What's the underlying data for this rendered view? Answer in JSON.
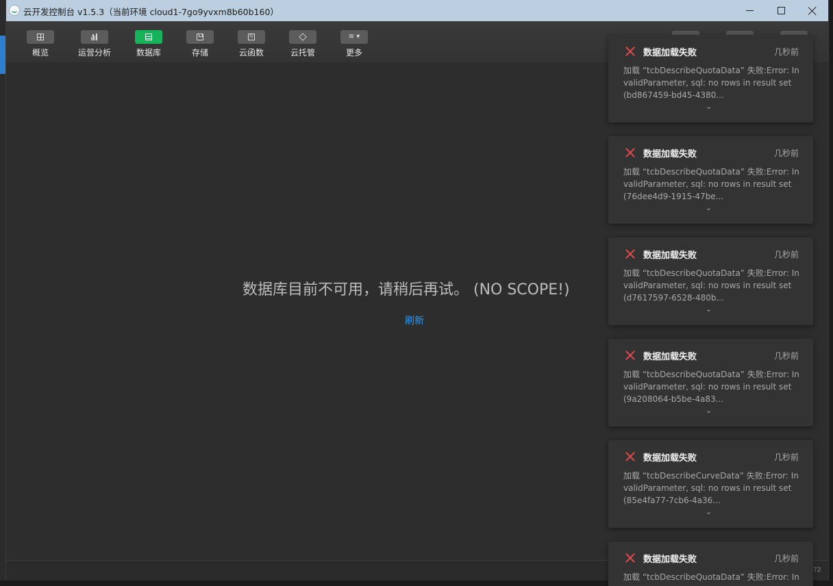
{
  "window": {
    "title": "云开发控制台 v1.5.3（当前环境 cloud1-7go9yvxm8b60b160）"
  },
  "toolbar": {
    "items": [
      {
        "label": "概览",
        "icon": "grid-icon"
      },
      {
        "label": "运营分析",
        "icon": "bar-chart-icon"
      },
      {
        "label": "数据库",
        "icon": "database-table-icon",
        "active": true
      },
      {
        "label": "存储",
        "icon": "disk-icon"
      },
      {
        "label": "云函数",
        "icon": "function-icon"
      },
      {
        "label": "云托管",
        "icon": "cube-icon"
      },
      {
        "label": "更多",
        "icon": "layers-dropdown-icon"
      }
    ]
  },
  "main": {
    "message": "数据库目前不可用，请稍后再试。 (NO SCOPE!)",
    "refresh": "刷新"
  },
  "status": {
    "number": "72"
  },
  "toasts": [
    {
      "title": "数据加载失败",
      "time": "几秒前",
      "body": "加载 “tcbDescribeQuotaData” 失败:Error: InvalidParameter, sql: no rows in result set (bd867459-bd45-4380...",
      "chevron": "⌄"
    },
    {
      "title": "数据加载失败",
      "time": "几秒前",
      "body": "加载 “tcbDescribeQuotaData” 失败:Error: InvalidParameter, sql: no rows in result set (76dee4d9-1915-47be...",
      "chevron": "⌄"
    },
    {
      "title": "数据加载失败",
      "time": "几秒前",
      "body": "加载 “tcbDescribeQuotaData” 失败:Error: InvalidParameter, sql: no rows in result set (d7617597-6528-480b...",
      "chevron": "⌄"
    },
    {
      "title": "数据加载失败",
      "time": "几秒前",
      "body": "加载 “tcbDescribeQuotaData” 失败:Error: InvalidParameter, sql: no rows in result set (9a208064-b5be-4a83...",
      "chevron": "⌄"
    },
    {
      "title": "数据加载失败",
      "time": "几秒前",
      "body": "加载 “tcbDescribeCurveData” 失败:Error: InvalidParameter, sql: no rows in result set (85e4fa77-7cb6-4a36...",
      "chevron": "⌄"
    },
    {
      "title": "数据加载失败",
      "time": "几秒前",
      "body": "加载 “tcbDescribeQuotaData” 失败:Error: Inv",
      "chevron": ""
    }
  ],
  "colors": {
    "accent_active": "#16b35a",
    "error": "#e5484d",
    "link": "#2d9bf0"
  }
}
